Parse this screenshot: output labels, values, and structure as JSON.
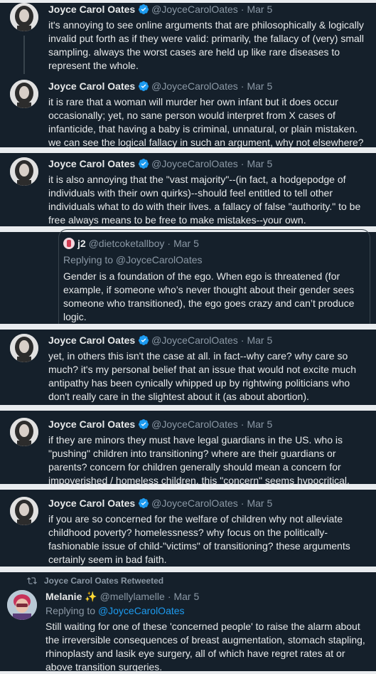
{
  "account": {
    "display_name": "Joyce Carol Oates",
    "handle": "@JoyceCarolOates"
  },
  "tweets": [
    {
      "date": "Mar 5",
      "text": "it's annoying to see online arguments that are philosophically & logically invalid put forth as if they were valid: primarily, the fallacy of (very) small sampling. always the worst cases are held up like rare diseases to represent the whole."
    },
    {
      "date": "Mar 5",
      "text": "it is rare that a woman will murder her own infant but it does occur occasionally; yet, no sane person would interpret from X cases of infanticide, that having a baby is criminal, unnatural, or plain mistaken. we can see the logical fallacy in such an argument, why not elsewhere?"
    },
    {
      "date": "Mar 5",
      "text": "it is also annoying that the \"vast majority\"--(in fact, a hodgepodge of individuals with their own quirks)--should feel entitled to tell other individuals what to do with their lives. a fallacy of false \"authority.\" to be free always means to be free to make mistakes--your own."
    },
    {
      "date": "Mar 5",
      "text": "yet, in others this isn't the case at all. in fact--why care? why care so much? it's my personal belief that an issue that would not excite much antipathy has been cynically whipped up by rightwing politicians who don't really care in the slightest about it (as about abortion)."
    },
    {
      "date": "Mar 5",
      "text": "if they are minors they must have legal guardians in the US. who is \"pushing\" children into transitioning? where are their guardians or parents? concern for children generally should mean a concern for impoverished / homeless children.  this \"concern\" seems hypocritical."
    },
    {
      "date": "Mar 5",
      "text": "if you are so concerned for the welfare of children why not alleviate childhood poverty? homelessness? why focus on the  politically-fashionable issue of child-\"victims\" of transitioning? these arguments certainly seem in bad faith."
    }
  ],
  "quote": {
    "name": "j2",
    "handle": "@dietcoketallboy",
    "date": "Mar 5",
    "replying_to": "Replying to @JoyceCarolOates",
    "text": "Gender is a foundation of the ego. When ego is threatened (for example, if someone who’s never thought about their gender sees someone who transitioned), the ego goes crazy and can’t produce logic."
  },
  "retweet": {
    "label": "Joyce Carol Oates Retweeted",
    "name": "Melanie",
    "handle": "@mellylamelle",
    "date": "Mar 5",
    "replying_prefix": "Replying to",
    "replying_handle": "@JoyceCarolOates",
    "text": "Still waiting for one of these 'concerned people' to raise the alarm about the irreversible consequences of breast augmentation, stomach stapling, rhinoplasty and lasik eye surgery, all of which have regret rates at or above transition surgeries."
  },
  "sep": "·",
  "colors": {
    "background": "#15202b",
    "panel_border": "#e9ecef",
    "text": "#e7e9ea",
    "secondary": "#8b98a5",
    "accent": "#1d9bf0"
  }
}
